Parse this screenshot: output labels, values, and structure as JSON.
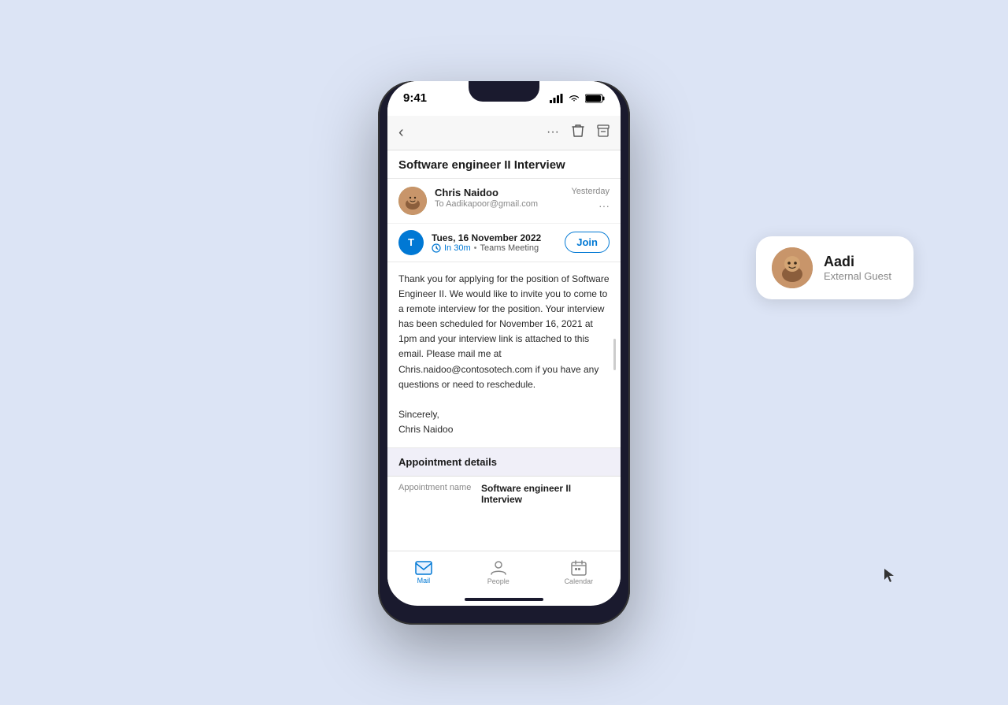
{
  "background_color": "#dce4f5",
  "status_bar": {
    "time": "9:41",
    "battery_icon": "🔋",
    "signal_icon": "📶",
    "wifi_icon": "📡"
  },
  "toolbar": {
    "back_label": "‹",
    "more_label": "···",
    "delete_label": "🗑",
    "archive_label": "🗄"
  },
  "email": {
    "subject": "Software engineer II Interview",
    "sender": {
      "name": "Chris Naidoo",
      "to": "To Aadikapoor@gmail.com",
      "time": "Yesterday"
    },
    "meeting": {
      "date": "Tues, 16 November 2022",
      "time_label": "In 30m",
      "type": "Teams Meeting",
      "join_label": "Join"
    },
    "body": "Thank you for applying for the position of Software Engineer II. We would like to invite you to come to a remote interview for the position. Your interview has been scheduled for November 16, 2021 at 1pm and your interview link is attached to this email. Please mail me at Chris.naidoo@contosotech.com if you have any questions or need to reschedule.",
    "signature": "Sincerely,\nChris Naidoo"
  },
  "appointment": {
    "section_title": "Appointment details",
    "label": "Appointment name",
    "value": "Software engineer II Interview"
  },
  "bottom_nav": {
    "items": [
      {
        "label": "Mail",
        "active": true
      },
      {
        "label": "People",
        "active": false
      },
      {
        "label": "Calendar",
        "active": false
      }
    ]
  },
  "guest_card": {
    "name": "Aadi",
    "role": "External Guest"
  }
}
